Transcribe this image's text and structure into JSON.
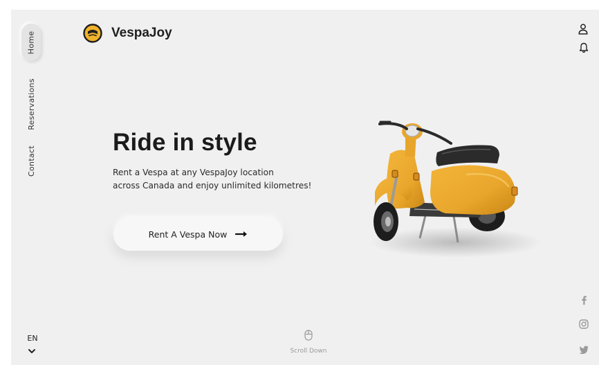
{
  "brand": {
    "name": "VespaJoy",
    "logo_icon": "helmet-icon",
    "accent_color": "#f1b32b"
  },
  "nav": {
    "items": [
      {
        "label": "Home",
        "active": true
      },
      {
        "label": "Reservations",
        "active": false
      },
      {
        "label": "Contact",
        "active": false
      }
    ]
  },
  "header": {
    "icons": [
      "user-icon",
      "bell-icon"
    ]
  },
  "hero": {
    "title": "Ride in style",
    "description_line1": "Rent a Vespa at any VespaJoy location",
    "description_line2": "across Canada and enjoy unlimited kilometres!",
    "cta_label": "Rent A Vespa Now",
    "cta_icon": "arrow-right-icon",
    "scooter_color": "#e9a62c"
  },
  "footer": {
    "language": "EN",
    "language_icon": "chevron-down-icon",
    "scroll_label": "Scroll Down",
    "scroll_icon": "mouse-icon"
  },
  "social": {
    "icons": [
      "facebook-icon",
      "instagram-icon",
      "twitter-icon"
    ]
  }
}
